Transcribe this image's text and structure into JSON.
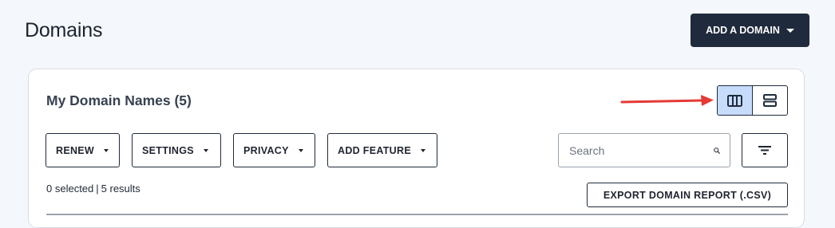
{
  "header": {
    "title": "Domains",
    "add_domain_label": "ADD A DOMAIN"
  },
  "card": {
    "title": "My Domain Names (5)"
  },
  "view_toggle": {
    "options": [
      "column-view-icon",
      "row-view-icon"
    ],
    "active": "column-view-icon"
  },
  "toolbar": {
    "renew": "RENEW",
    "settings": "SETTINGS",
    "privacy": "PRIVACY",
    "add_feature": "ADD FEATURE"
  },
  "search": {
    "placeholder": "Search",
    "value": ""
  },
  "status": {
    "selected": "0 selected",
    "separator": "|",
    "results": "5 results"
  },
  "export": {
    "label": "EXPORT DOMAIN REPORT (.CSV)"
  },
  "colors": {
    "primary": "#1f2b3c",
    "active_toggle": "#c7dcfb",
    "annotation_arrow": "#e53935",
    "background": "#f4f7fb"
  }
}
